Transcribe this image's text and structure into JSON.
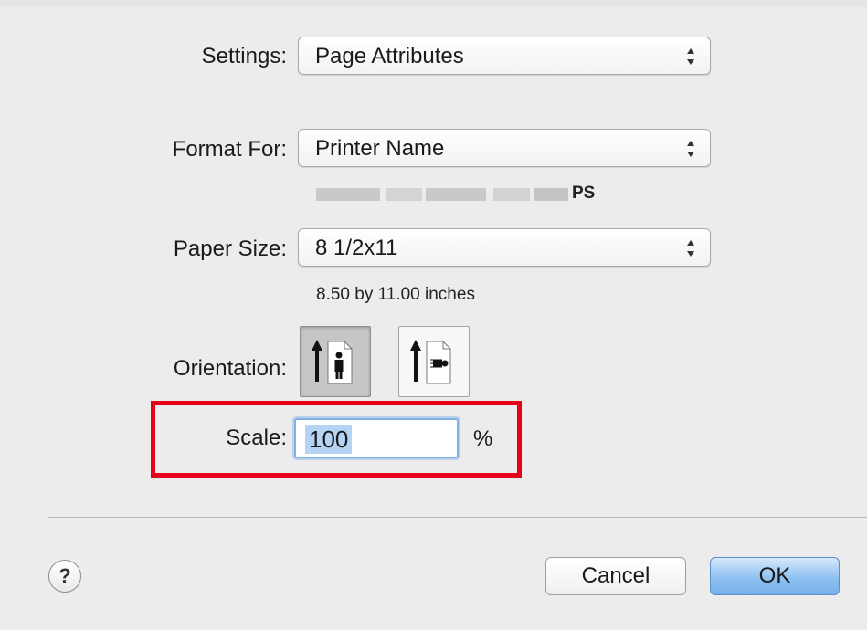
{
  "settings": {
    "label": "Settings:",
    "value": "Page Attributes"
  },
  "format_for": {
    "label": "Format For:",
    "value": "Printer Name",
    "printer_detail_suffix": "PS"
  },
  "paper_size": {
    "label": "Paper Size:",
    "value": "8 1/2x11",
    "description": "8.50 by 11.00 inches"
  },
  "orientation": {
    "label": "Orientation:",
    "selected": "portrait"
  },
  "scale": {
    "label": "Scale:",
    "value": "100",
    "unit": "%"
  },
  "footer": {
    "help_label": "?",
    "cancel_label": "Cancel",
    "ok_label": "OK"
  },
  "colors": {
    "highlight": "#e8001a",
    "focus": "#7fb0e6",
    "ok_button": "#8fc1f1"
  }
}
